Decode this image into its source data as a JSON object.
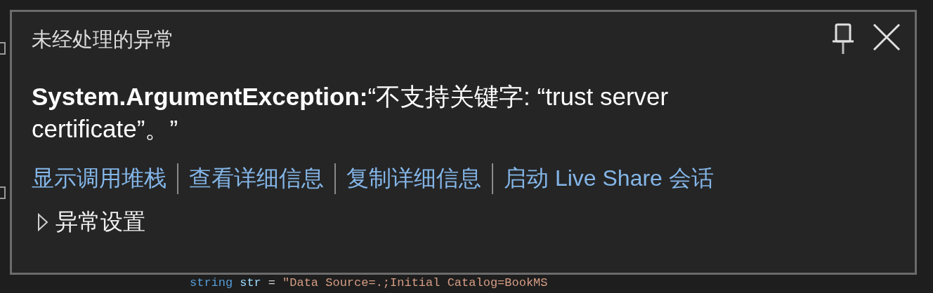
{
  "dialog": {
    "title": "未经处理的异常",
    "pinned": false,
    "message": "**System.ArgumentException:**“不支持关键字: “trust server certificate”。”",
    "links": [
      {
        "label": "显示调用堆栈"
      },
      {
        "label": "查看详细信息"
      },
      {
        "label": "复制详细信息"
      },
      {
        "label": "启动 Live Share 会话"
      }
    ],
    "settings": {
      "label": "异常设置",
      "expanded": false
    }
  },
  "code_line": [
    {
      "kind": "keyword",
      "text": "string"
    },
    {
      "kind": "name",
      "text": "str"
    },
    {
      "kind": "plain",
      "text": "="
    },
    {
      "kind": "string",
      "text": "\"Data Source=.;Initial Catalog=BookMS"
    }
  ]
}
